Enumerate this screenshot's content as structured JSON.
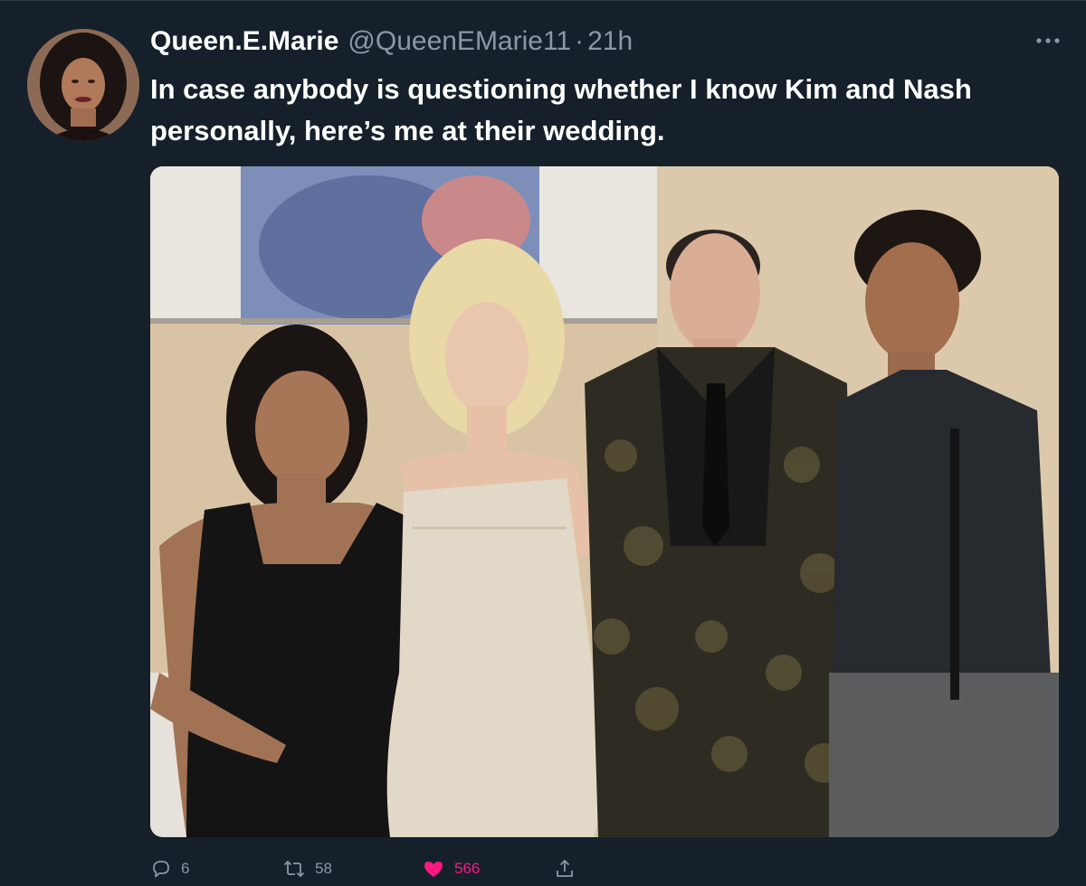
{
  "tweet": {
    "display_name": "Queen.E.Marie",
    "handle": "@QueenEMarie11",
    "separator": "·",
    "time": "21h",
    "text": "In case anybody is questioning whether I know Kim and Nash personally, here’s me at their wedding.",
    "avatar_icon": "profile-photo",
    "more_icon": "more-options-icon"
  },
  "actions": {
    "reply": {
      "icon": "reply-icon",
      "count": "6"
    },
    "retweet": {
      "icon": "retweet-icon",
      "count": "58"
    },
    "like": {
      "icon": "heart-icon",
      "count": "566",
      "color": "#f91880"
    },
    "share": {
      "icon": "share-icon"
    }
  },
  "colors": {
    "background": "#15202b",
    "text_primary": "#ffffff",
    "text_secondary": "#8b98a5",
    "like_active": "#f91880"
  }
}
